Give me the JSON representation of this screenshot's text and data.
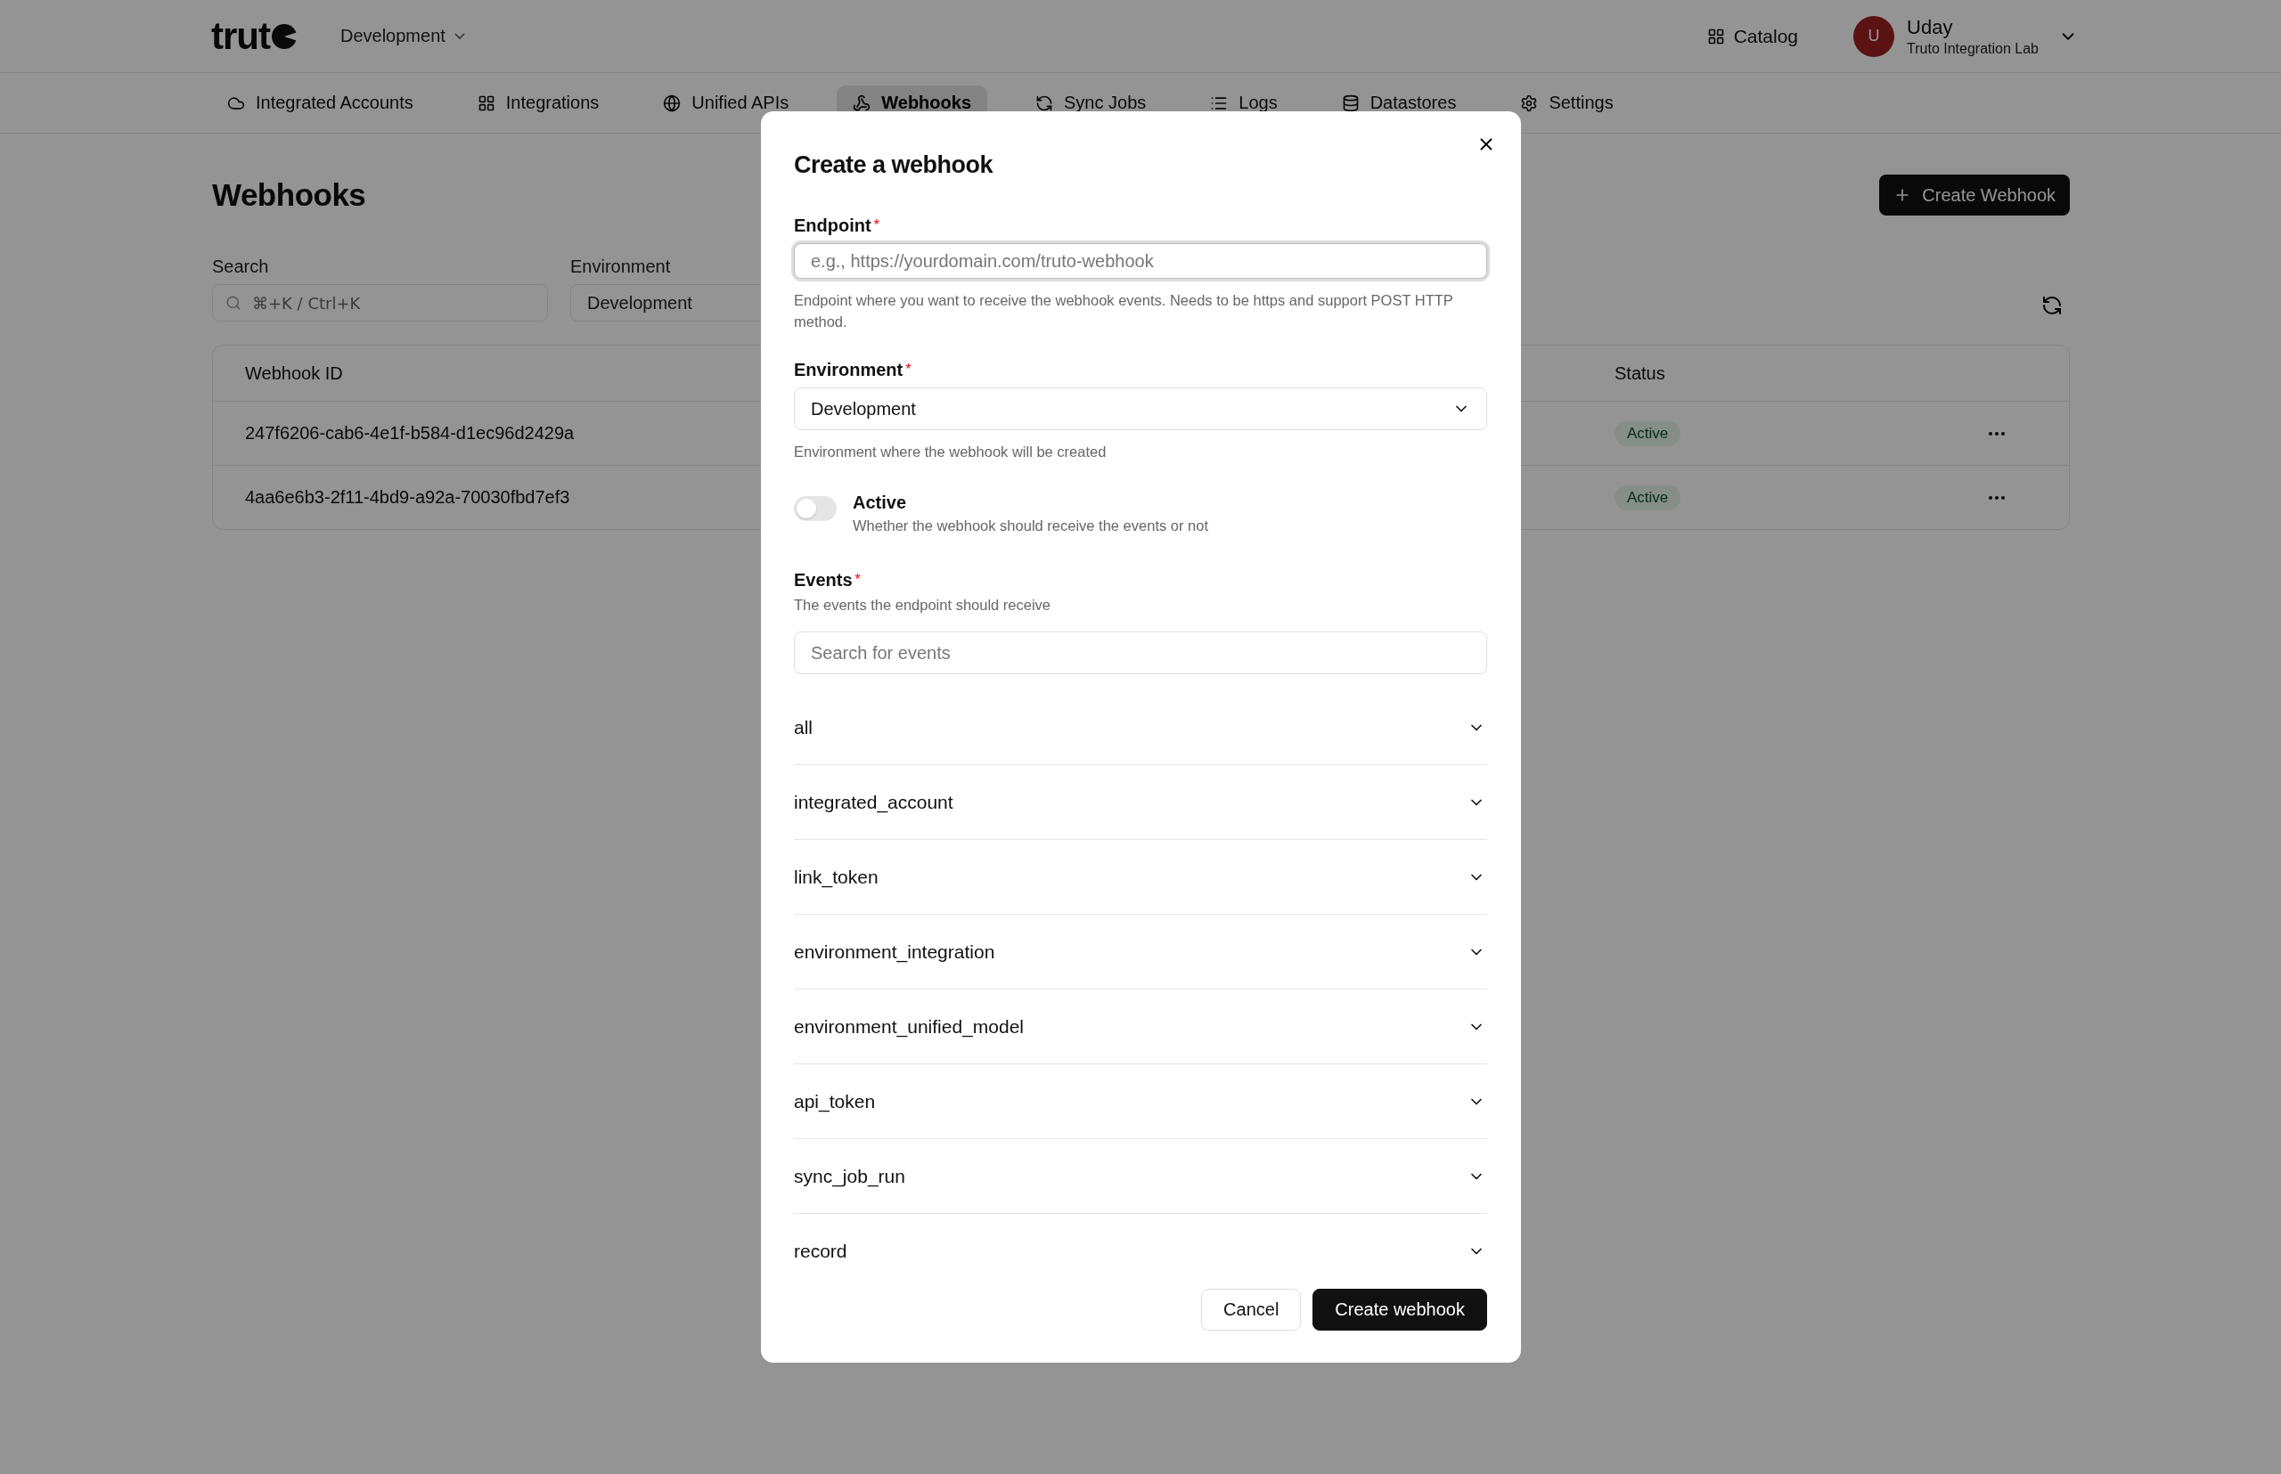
{
  "header": {
    "logo": "trut",
    "environment": "Development",
    "catalog": "Catalog",
    "user": {
      "initial": "U",
      "name": "Uday",
      "org": "Truto Integration Lab"
    }
  },
  "nav": [
    {
      "label": "Integrated Accounts",
      "selected": false
    },
    {
      "label": "Integrations",
      "selected": false
    },
    {
      "label": "Unified APIs",
      "selected": false
    },
    {
      "label": "Webhooks",
      "selected": true
    },
    {
      "label": "Sync Jobs",
      "selected": false
    },
    {
      "label": "Logs",
      "selected": false
    },
    {
      "label": "Datastores",
      "selected": false
    },
    {
      "label": "Settings",
      "selected": false
    }
  ],
  "page": {
    "title": "Webhooks",
    "create_button": "Create Webhook",
    "filters": {
      "search_label": "Search",
      "search_placeholder": "⌘+K / Ctrl+K",
      "environment_label": "Environment",
      "environment_value": "Development"
    },
    "table": {
      "columns": [
        "Webhook ID",
        "Status"
      ],
      "rows": [
        {
          "id": "247f6206-cab6-4e1f-b584-d1ec96d2429a",
          "status": "Active"
        },
        {
          "id": "4aa6e6b3-2f11-4bd9-a92a-70030fbd7ef3",
          "status": "Active"
        }
      ]
    }
  },
  "dialog": {
    "title": "Create a webhook",
    "endpoint": {
      "label": "Endpoint",
      "required_mark": "*",
      "placeholder": "e.g., https://yourdomain.com/truto-webhook",
      "help": "Endpoint where you want to receive the webhook events. Needs to be https and support POST HTTP method."
    },
    "environment": {
      "label": "Environment",
      "required_mark": "*",
      "value": "Development",
      "help": "Environment where the webhook will be created"
    },
    "active": {
      "label": "Active",
      "description": "Whether the webhook should receive the events or not",
      "on": false
    },
    "events": {
      "label": "Events",
      "required_mark": "*",
      "description": "The events the endpoint should receive",
      "search_placeholder": "Search for events",
      "groups": [
        {
          "name": "all",
          "expanded": false
        },
        {
          "name": "integrated_account",
          "expanded": false
        },
        {
          "name": "link_token",
          "expanded": false
        },
        {
          "name": "environment_integration",
          "expanded": false
        },
        {
          "name": "environment_unified_model",
          "expanded": false
        },
        {
          "name": "api_token",
          "expanded": false
        },
        {
          "name": "sync_job_run",
          "expanded": false
        },
        {
          "name": "record",
          "expanded": false
        }
      ]
    },
    "buttons": [
      {
        "label": "Cancel",
        "kind": "secondary"
      },
      {
        "label": "Create webhook",
        "kind": "primary"
      }
    ]
  }
}
